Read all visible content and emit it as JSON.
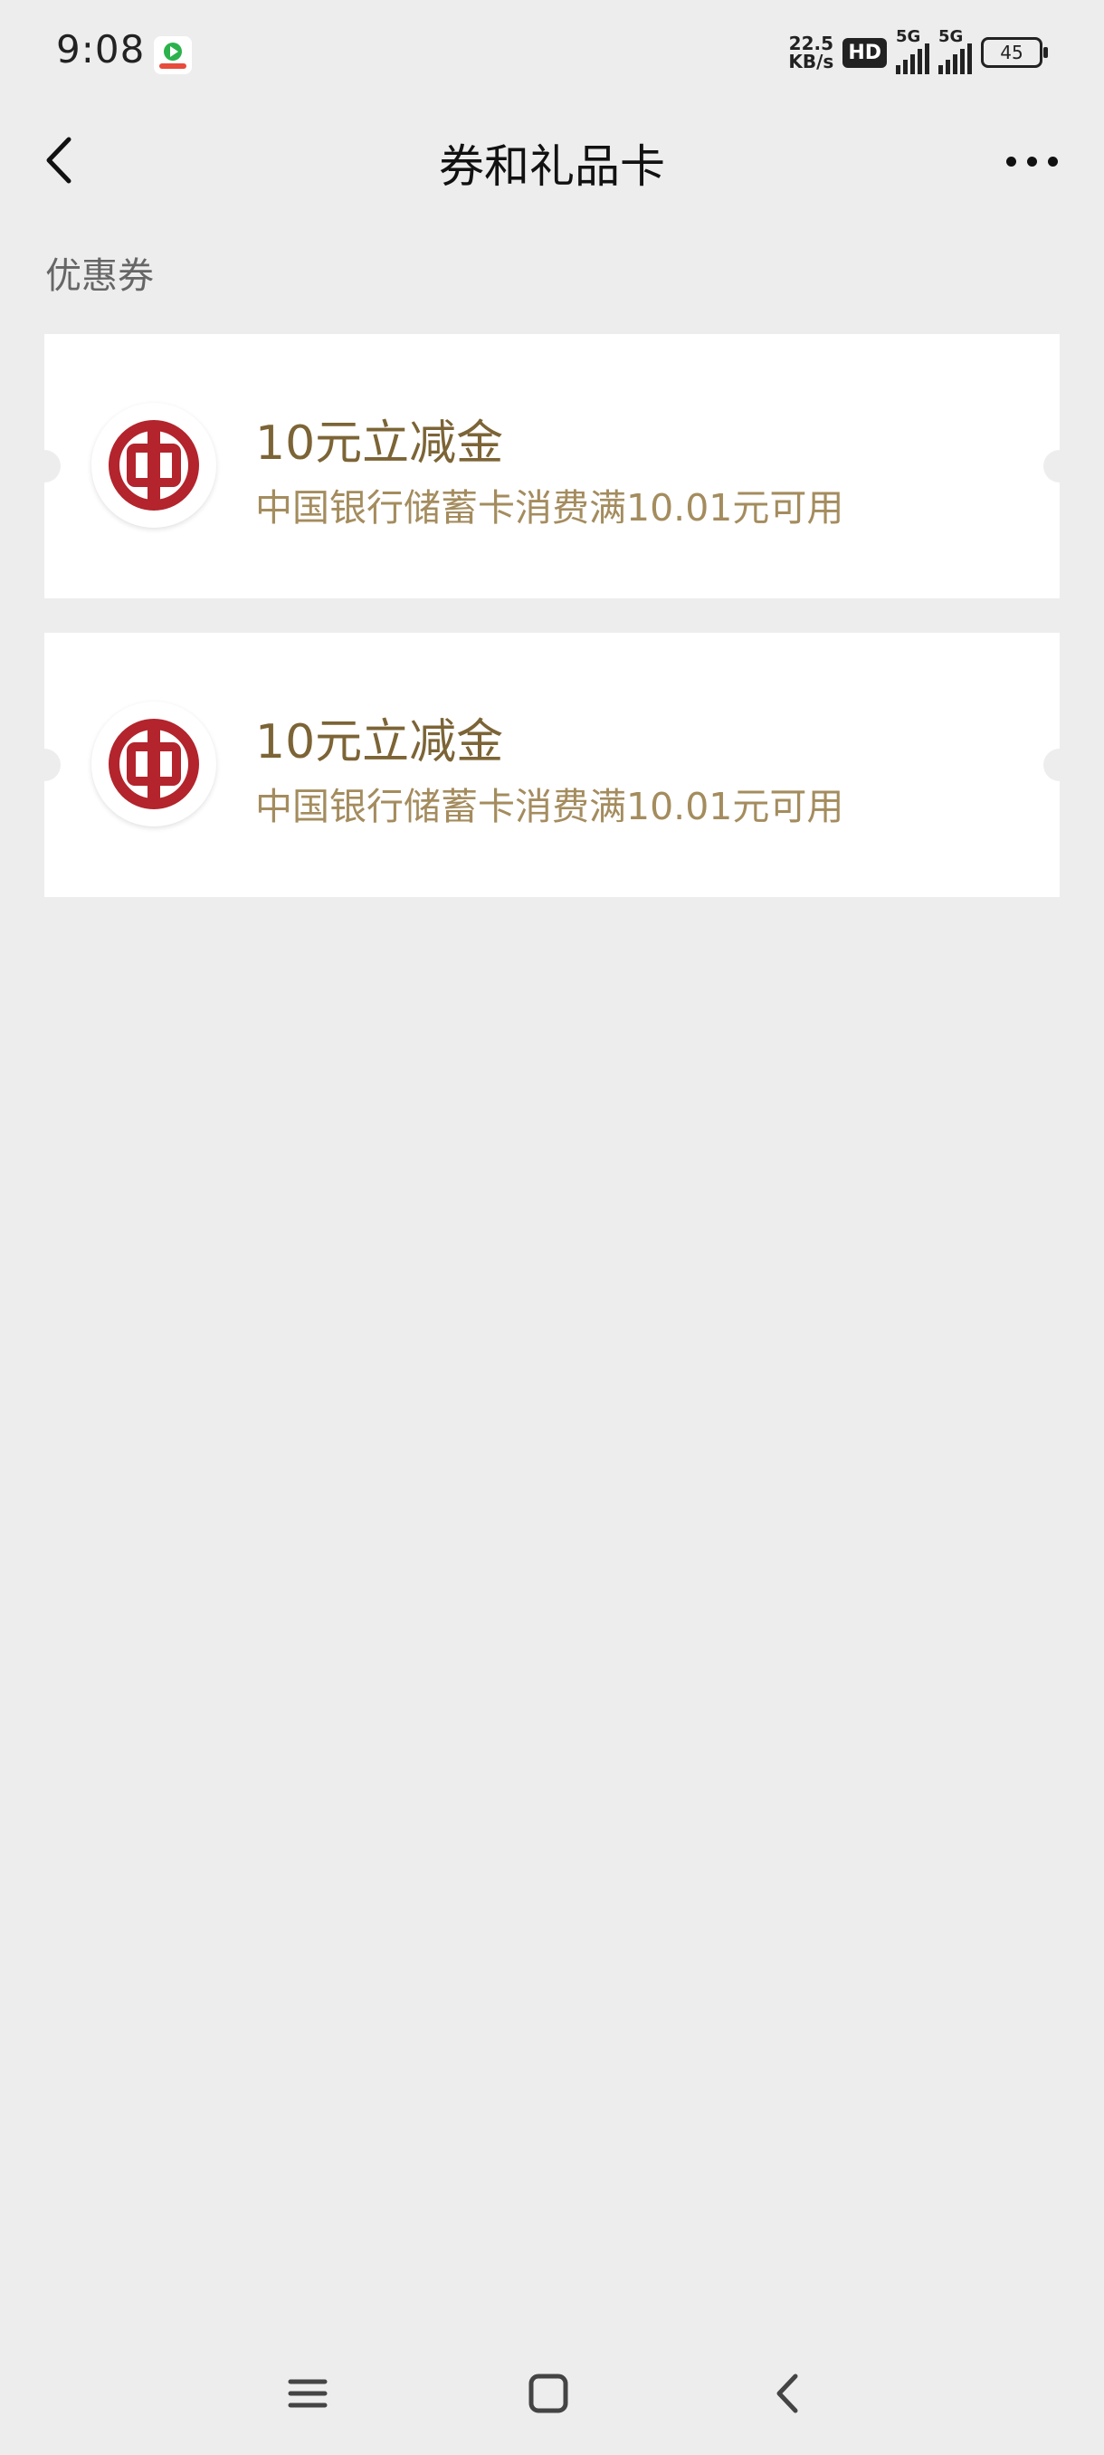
{
  "status_bar": {
    "time": "9:08",
    "net_speed_value": "22.5",
    "net_speed_unit": "KB/s",
    "hd_label": "HD",
    "sig1_label": "5G",
    "sig2_label": "5G",
    "battery": "45"
  },
  "nav": {
    "title": "券和礼品卡",
    "back_icon": "chevron-left-icon",
    "more_icon": "more-dots-icon"
  },
  "section": {
    "title": "优惠券"
  },
  "coupons": [
    {
      "title": "10元立减金",
      "desc": "中国银行储蓄卡消费满10.01元可用",
      "logo_icon": "bank-of-china-logo"
    },
    {
      "title": "10元立减金",
      "desc": "中国银行储蓄卡消费满10.01元可用",
      "logo_icon": "bank-of-china-logo"
    }
  ],
  "colors": {
    "background": "#ededed",
    "card": "#ffffff",
    "coupon_title": "#7c6436",
    "coupon_desc": "#a48c5e",
    "logo_red": "#b3242c"
  },
  "bottom_nav": {
    "icons": [
      "menu-icon",
      "home-icon",
      "back-icon"
    ]
  }
}
